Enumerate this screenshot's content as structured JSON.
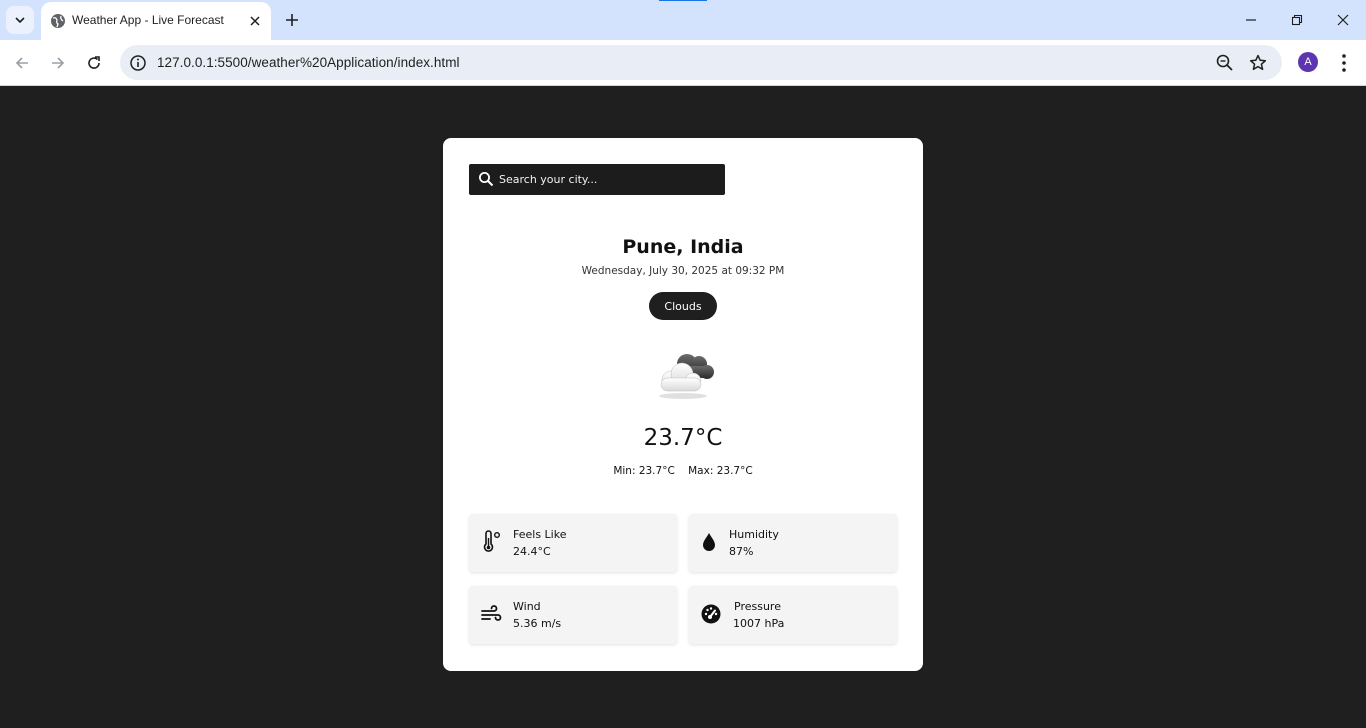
{
  "browser": {
    "tab_title": "Weather App - Live Forecast",
    "url": "127.0.0.1:5500/weather%20Application/index.html",
    "profile_initial": "A",
    "icons": [
      "tab-search-icon",
      "globe-icon",
      "close-icon",
      "plus-icon",
      "minimize-icon",
      "restore-icon",
      "back-icon",
      "forward-icon",
      "reload-icon",
      "info-icon",
      "zoom-icon",
      "star-icon",
      "more-icon"
    ]
  },
  "search": {
    "placeholder": "Search your city..."
  },
  "weather": {
    "city": "Pune, India",
    "datetime": "Wednesday, July 30, 2025 at 09:32 PM",
    "condition": "Clouds",
    "condition_icon": "cloud-icon",
    "temperature": "23.7°C",
    "min": "Min: 23.7°C",
    "max": "Max: 23.7°C"
  },
  "stats": {
    "feels_like": {
      "label": "Feels Like",
      "value": "24.4°C",
      "icon": "thermometer-icon"
    },
    "humidity": {
      "label": "Humidity",
      "value": "87%",
      "icon": "droplet-icon"
    },
    "wind": {
      "label": "Wind",
      "value": "5.36 m/s",
      "icon": "wind-icon"
    },
    "pressure": {
      "label": "Pressure",
      "value": "1007 hPa",
      "icon": "gauge-icon"
    }
  },
  "colors": {
    "page_background": "#1f1f1f",
    "card": "#ffffff",
    "search_box": "#1c1c1c",
    "condition_pill": "#1f1f1f",
    "stat_box": "#f4f4f4",
    "tab_strip": "#d3e3fd"
  }
}
